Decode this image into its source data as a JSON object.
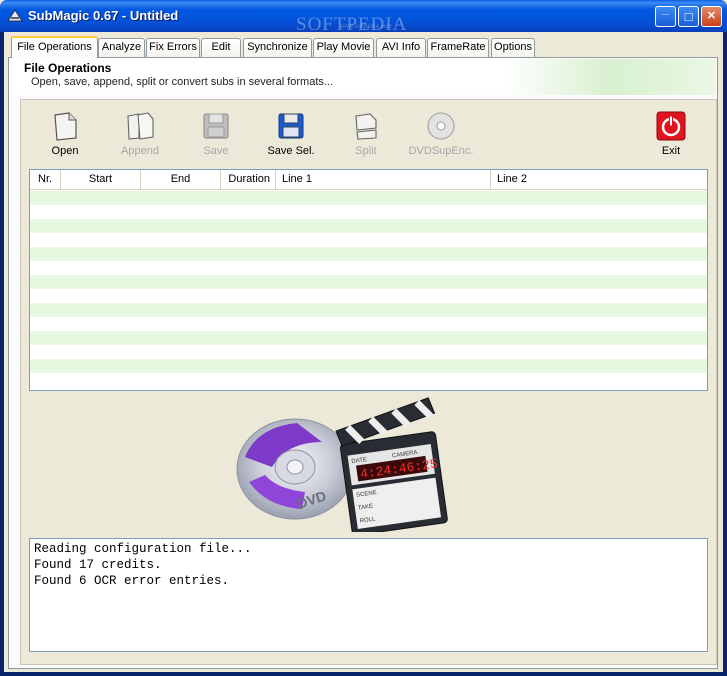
{
  "window": {
    "title": "SubMagic 0.67 - Untitled",
    "watermark": "SOFTPEDIA",
    "watermark_sub": "www.softpedia.com",
    "controls": [
      "_",
      "□",
      "✕"
    ]
  },
  "tabs": [
    {
      "label": "File Operations",
      "active": true
    },
    {
      "label": "Analyze"
    },
    {
      "label": "Fix Errors"
    },
    {
      "label": "Edit"
    },
    {
      "label": "Synchronize"
    },
    {
      "label": "Play Movie"
    },
    {
      "label": "AVI Info"
    },
    {
      "label": "FrameRate"
    },
    {
      "label": "Options"
    }
  ],
  "header": {
    "title": "File Operations",
    "description": "Open, save, append, split or convert subs in several formats..."
  },
  "toolbar": [
    {
      "label": "Open",
      "icon": "open-document-icon",
      "enabled": true
    },
    {
      "label": "Append",
      "icon": "append-documents-icon",
      "enabled": false
    },
    {
      "label": "Save",
      "icon": "floppy-disk-icon",
      "enabled": false
    },
    {
      "label": "Save Sel.",
      "icon": "floppy-disk-icon",
      "enabled": true
    },
    {
      "label": "Split",
      "icon": "split-documents-icon",
      "enabled": false
    },
    {
      "label": "DVDSupEnc.",
      "icon": "dvd-disc-icon",
      "enabled": false
    },
    {
      "label": "Exit",
      "icon": "power-exit-icon",
      "enabled": true
    }
  ],
  "grid": {
    "columns": [
      "Nr.",
      "Start",
      "End",
      "Duration",
      "Line 1",
      "Line 2"
    ],
    "rows": []
  },
  "splash": {
    "icon": "dvd-clapperboard-icon",
    "clapper_labels": [
      "DATE",
      "CAMERA",
      "SCENE",
      "TAKE",
      "ROLL"
    ],
    "timecode": "4:24:46:25"
  },
  "log": [
    "Reading configuration file...",
    "Found 17 credits.",
    "Found 6 OCR error entries."
  ],
  "colors": {
    "title_bar": "#0058e0",
    "active_tab_accent": "#ffc83c",
    "grid_alt_row": "#e6f8e0",
    "exit_red": "#e0141e"
  }
}
